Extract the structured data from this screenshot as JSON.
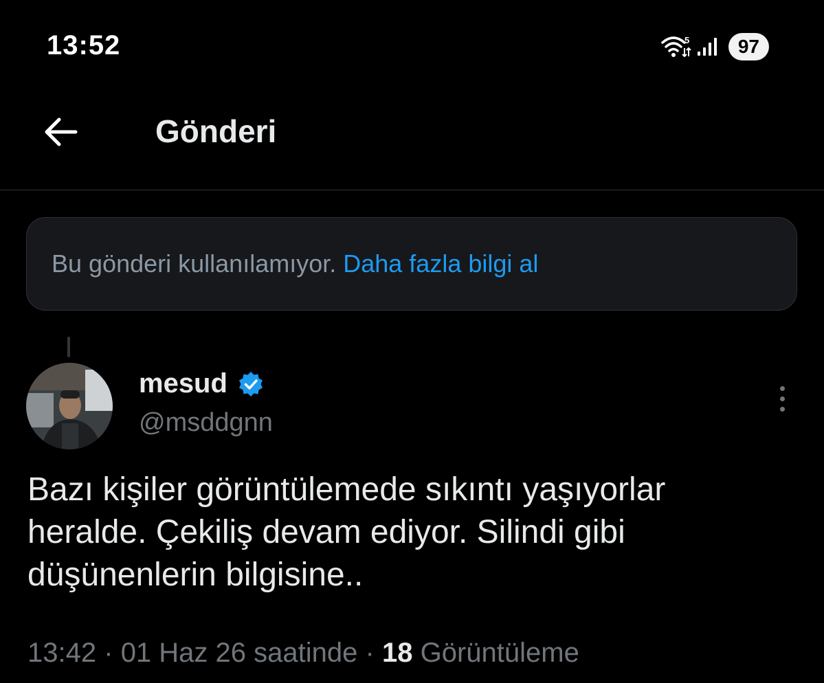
{
  "status_bar": {
    "time": "13:52",
    "wifi_label": "5",
    "battery": "97",
    "icons": [
      "wifi-icon",
      "signal-icon"
    ]
  },
  "header": {
    "back_icon": "arrow-left-icon",
    "title": "Gönderi"
  },
  "notice": {
    "text": "Bu gönderi kullanılamıyor.",
    "link": "Daha fazla bilgi al"
  },
  "post": {
    "author": {
      "display_name": "mesud",
      "handle": "@msddgnn",
      "verified": true
    },
    "text_lines": [
      "Bazı kişiler görüntülemede sıkıntı yaşıyorlar",
      "heralde. Çekiliş devam ediyor. Silindi gibi",
      "düşünenlerin bilgisine.."
    ],
    "time": "13:42",
    "date": "01 Haz 26 saatinde",
    "separator": "·",
    "views_count": "18",
    "views_label": "Görüntüleme"
  },
  "colors": {
    "background": "#000000",
    "link": "#1d9bf0",
    "muted": "#71767b",
    "verified": "#1d9bf0"
  }
}
